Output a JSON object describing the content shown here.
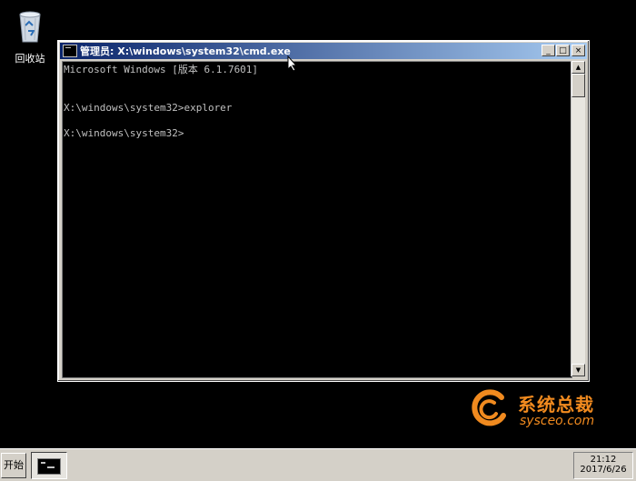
{
  "desktop": {
    "recycle_bin_label": "回收站"
  },
  "window": {
    "title": "管理员: X:\\windows\\system32\\cmd.exe",
    "controls": {
      "minimize": "_",
      "maximize": "□",
      "close": "×"
    },
    "console_lines": [
      "Microsoft Windows [版本 6.1.7601]",
      "",
      "",
      "X:\\windows\\system32>explorer",
      "",
      "X:\\windows\\system32>"
    ]
  },
  "watermark": {
    "cn": "系统总裁",
    "en": "sysceo.com",
    "color": "#f08a1f"
  },
  "taskbar": {
    "start_label": "开始",
    "task_icon": "cmd-icon",
    "clock_time": "21:12",
    "clock_date": "2017/6/26"
  }
}
